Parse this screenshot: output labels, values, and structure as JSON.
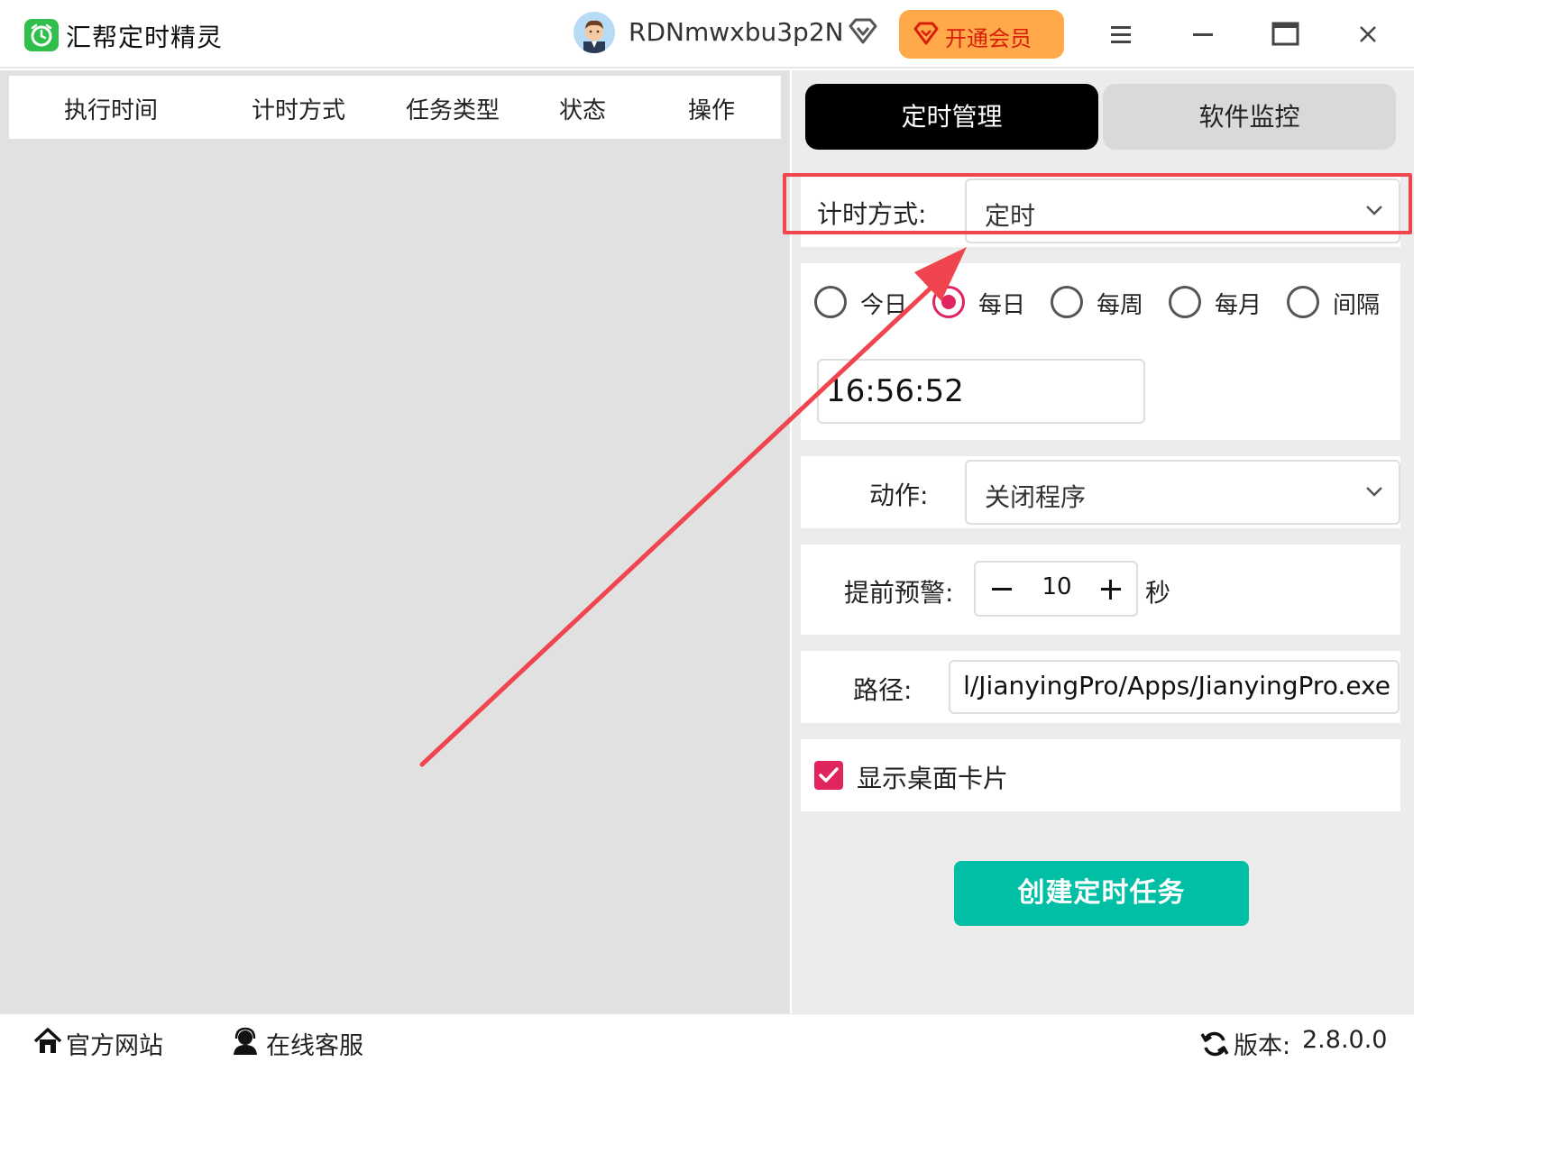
{
  "titlebar": {
    "app_name": "汇帮定时精灵",
    "username": "RDNmwxbu3p2N",
    "vip_label": "开通会员"
  },
  "table": {
    "headers": [
      "执行时间",
      "计时方式",
      "任务类型",
      "状态",
      "操作"
    ]
  },
  "tabs": {
    "active": "定时管理",
    "inactive": "软件监控"
  },
  "form": {
    "timing_label": "计时方式:",
    "timing_value": "定时",
    "radios": [
      {
        "label": "今日",
        "checked": false
      },
      {
        "label": "每日",
        "checked": true
      },
      {
        "label": "每周",
        "checked": false
      },
      {
        "label": "每月",
        "checked": false
      },
      {
        "label": "间隔",
        "checked": false
      }
    ],
    "time_value": "16:56:52",
    "action_label": "动作:",
    "action_value": "关闭程序",
    "warning_label": "提前预警:",
    "warning_value": "10",
    "warning_unit": "秒",
    "path_label": "路径:",
    "path_value": "l/JianyingPro/Apps/JianyingPro.exe",
    "show_card_label": "显示桌面卡片",
    "show_card_checked": true,
    "create_button": "创建定时任务"
  },
  "footer": {
    "website": "官方网站",
    "support": "在线客服",
    "version_label": "版本:",
    "version_value": "2.8.0.0"
  },
  "colors": {
    "accent_pink": "#e0245e",
    "create_button": "#00bfa5",
    "vip_button": "#ffa94a",
    "highlight": "#f0454f"
  },
  "icons": [
    "app-logo-icon",
    "avatar-icon",
    "diamond-icon",
    "vip-diamond-icon",
    "menu-icon",
    "minimize-icon",
    "maximize-icon",
    "close-icon",
    "chevron-down-icon",
    "home-icon",
    "support-icon",
    "refresh-icon",
    "checkmark-icon"
  ]
}
